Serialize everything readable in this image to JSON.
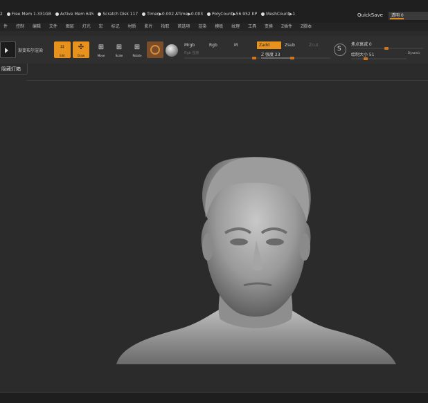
{
  "status": {
    "prefix": "2",
    "free_mem": "Free Mem 1.331GB",
    "active_mem": "Active Mem 645",
    "scratch_disk": "Scratch Disk 117",
    "timer": "Timer▶0.002 ATime▶0.003",
    "poly_count": "PolyCount▶56.952 KP",
    "mesh_count": "MeshCount▶1",
    "quicksave": "QuickSave",
    "transparency_label": "透明 0"
  },
  "menu": [
    "件",
    "控制",
    "编辑",
    "文件",
    "图层",
    "灯光",
    "宏",
    "标记",
    "材质",
    "影片",
    "拾取",
    "首选项",
    "渲染",
    "模板",
    "纹理",
    "工具",
    "变换",
    "Z插件",
    "Z脚本"
  ],
  "toolbar": {
    "label": "渐变布尔渲染",
    "btn_edit": "Edit",
    "btn_draw": "Draw",
    "btn_move": "Move",
    "btn_scale": "Scale",
    "btn_rotate": "Rotate",
    "mrgb": "Mrgb",
    "rgb": "Rgb",
    "m": "M",
    "zadd": "Zadd",
    "zsub": "Zsub",
    "zcut": "Zcut",
    "rgb_intensity": "Rgb 强度",
    "z_intensity": "Z 强度 23",
    "focal_shift": "焦点衰减 0",
    "draw_size": "绘制大小 51",
    "dynamic": "Dynamic"
  },
  "tooltip": "隐藏灯箱",
  "colors": {
    "accent": "#e8921e",
    "bg": "#2b2b2b",
    "bar": "#1f1f1f"
  }
}
